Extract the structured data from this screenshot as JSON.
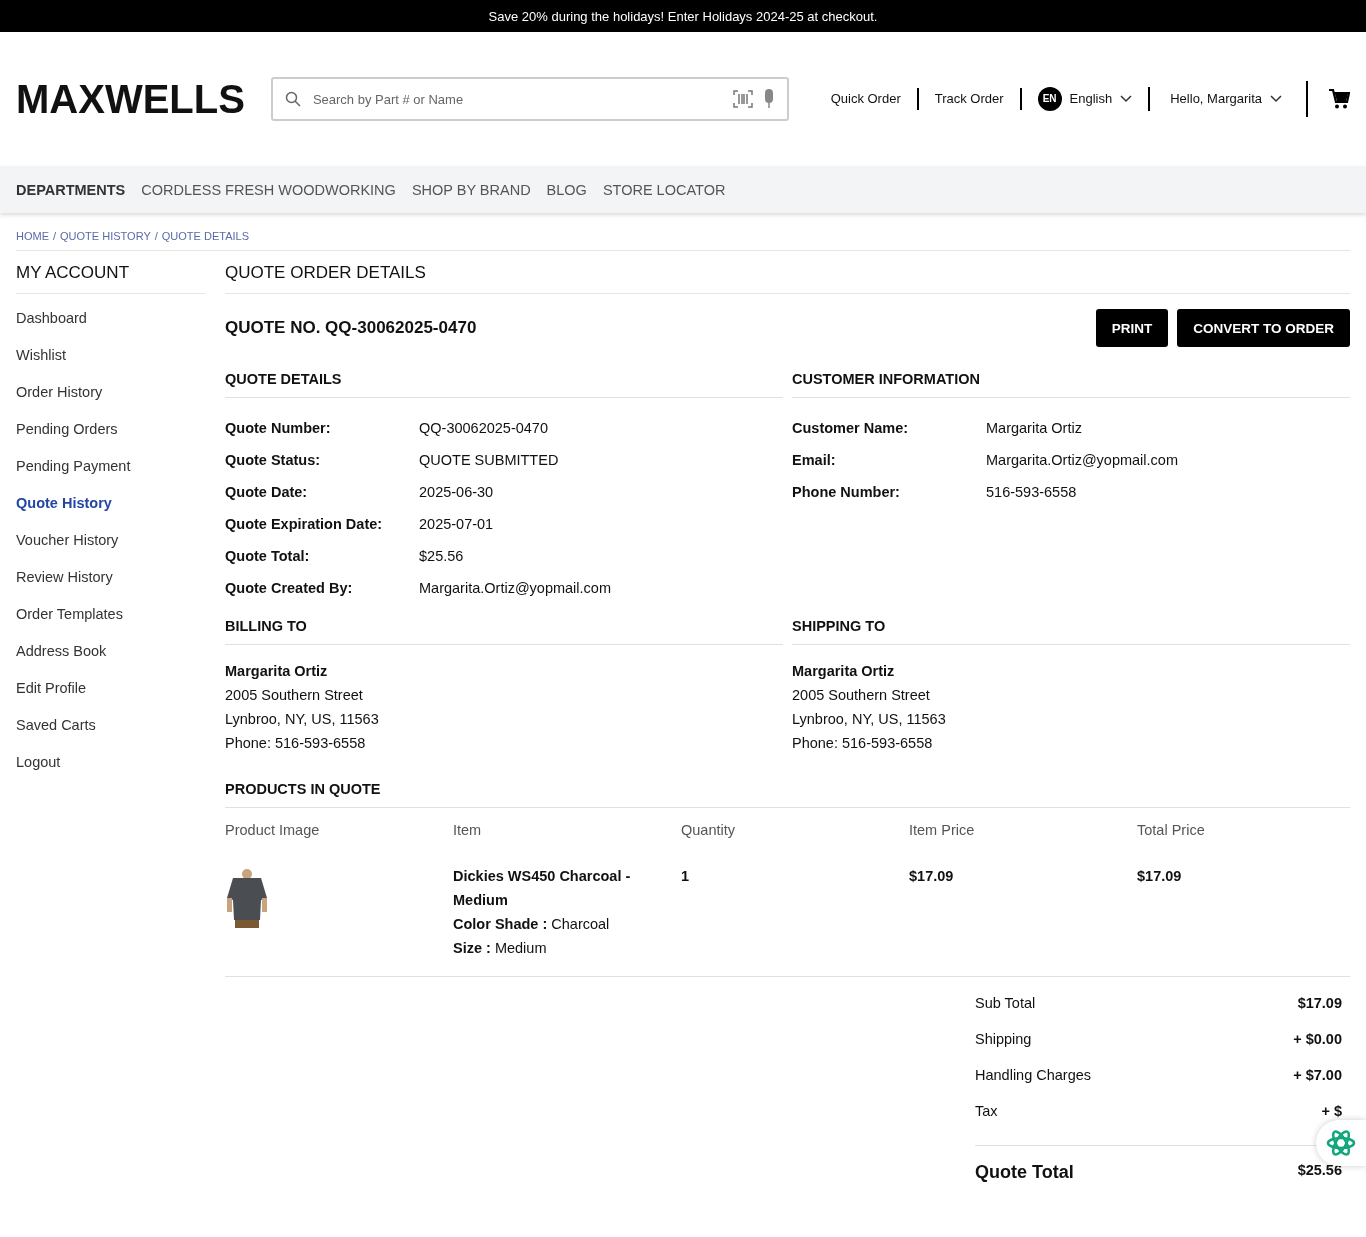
{
  "promo": "Save 20% during the holidays! Enter Holidays 2024-25 at checkout.",
  "logo": "MAXWELLS",
  "search": {
    "placeholder": "Search by Part # or Name"
  },
  "header_links": [
    "Quick Order",
    "Track Order"
  ],
  "language": {
    "badge": "EN",
    "label": "English"
  },
  "account": {
    "label": "Hello, Margarita"
  },
  "nav": [
    {
      "label": "DEPARTMENTS",
      "selected": true
    },
    {
      "label": "CORDLESS FRESH WOODWORKING",
      "selected": false
    },
    {
      "label": "SHOP BY BRAND",
      "selected": false
    },
    {
      "label": "BLOG",
      "selected": false
    },
    {
      "label": "STORE LOCATOR",
      "selected": false
    }
  ],
  "breadcrumb": {
    "separator": "/",
    "items": [
      "HOME",
      "QUOTE HISTORY",
      "QUOTE DETAILS"
    ]
  },
  "sidebar": {
    "title": "MY ACCOUNT",
    "items": [
      {
        "label": "Dashboard",
        "selected": false
      },
      {
        "label": "Wishlist",
        "selected": false
      },
      {
        "label": "Order History",
        "selected": false
      },
      {
        "label": "Pending Orders",
        "selected": false
      },
      {
        "label": "Pending Payment",
        "selected": false
      },
      {
        "label": "Quote History",
        "selected": true
      },
      {
        "label": "Voucher History",
        "selected": false
      },
      {
        "label": "Review History",
        "selected": false
      },
      {
        "label": "Order Templates",
        "selected": false
      },
      {
        "label": "Address Book",
        "selected": false
      },
      {
        "label": "Edit Profile",
        "selected": false
      },
      {
        "label": "Saved Carts",
        "selected": false
      },
      {
        "label": "Logout",
        "selected": false
      }
    ]
  },
  "page_title": "QUOTE ORDER DETAILS",
  "quote_no": "QUOTE NO. QQ-30062025-0470",
  "buttons": [
    "PRINT",
    "CONVERT TO ORDER"
  ],
  "quote_details": {
    "title": "QUOTE DETAILS",
    "rows": [
      {
        "label": "Quote Number:",
        "value": "QQ-30062025-0470"
      },
      {
        "label": "Quote Status:",
        "value": "QUOTE SUBMITTED"
      },
      {
        "label": "Quote Date:",
        "value": "2025-06-30"
      },
      {
        "label": "Quote Expiration Date:",
        "value": "2025-07-01"
      },
      {
        "label": "Quote Total:",
        "value": "$25.56"
      },
      {
        "label": "Quote Created By:",
        "value": "Margarita.Ortiz@yopmail.com"
      }
    ]
  },
  "customer": {
    "title": "CUSTOMER INFORMATION",
    "rows": [
      {
        "label": "Customer Name:",
        "value": "Margarita Ortiz"
      },
      {
        "label": "Email:",
        "value": "Margarita.Ortiz@yopmail.com"
      },
      {
        "label": "Phone Number:",
        "value": "516-593-6558"
      }
    ]
  },
  "billing": {
    "title": "BILLING TO",
    "name": "Margarita Ortiz",
    "lines": [
      "2005 Southern Street",
      "Lynbroo, NY, US, 11563",
      "Phone: 516-593-6558"
    ]
  },
  "shipping": {
    "title": "SHIPPING TO",
    "name": "Margarita Ortiz",
    "lines": [
      "2005 Southern Street",
      "Lynbroo, NY, US, 11563",
      "Phone: 516-593-6558"
    ]
  },
  "products": {
    "title": "PRODUCTS IN QUOTE",
    "columns": [
      "Product Image",
      "Item",
      "Quantity",
      "Item Price",
      "Total Price"
    ],
    "rows": [
      {
        "image": {
          "kind": "picture"
        },
        "name": "Dickies WS450 Charcoal - Medium",
        "attributes": [
          "**Color Shade :** Charcoal",
          "**Size :** Medium"
        ],
        "quantity": "1",
        "item_price": "$17.09",
        "total_price": "$17.09"
      }
    ]
  },
  "totals": [
    {
      "label": "Sub Total",
      "value": "$17.09"
    },
    {
      "label": "Shipping",
      "value": "+ $0.00"
    },
    {
      "label": "Handling Charges",
      "value": "+ $7.00"
    },
    {
      "label": "Tax",
      "value": "+ $"
    }
  ],
  "grand_total": {
    "label": "Quote Total",
    "value": "$25.56"
  }
}
